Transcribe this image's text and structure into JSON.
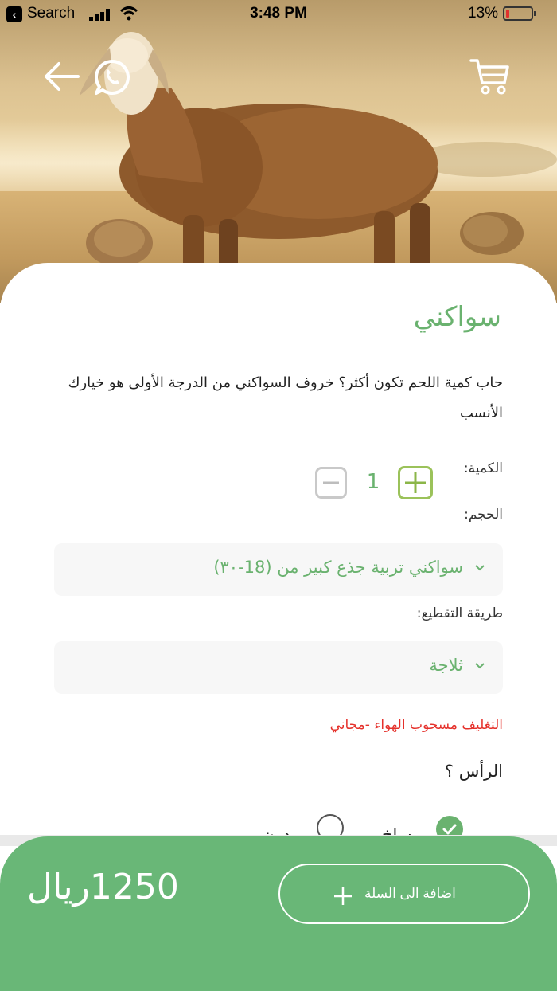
{
  "status_bar": {
    "back_app": "Search",
    "time": "3:48 PM",
    "battery_pct": "13%",
    "battery_level": 0.13
  },
  "product": {
    "title": "سواكني",
    "description": "حاب كمية اللحم تكون أكثر؟ خروف السواكني من الدرجة الأولى هو خيارك الأنسب"
  },
  "quantity": {
    "label": "الكمية:",
    "value": "1"
  },
  "size": {
    "label": "الحجم:",
    "selected": "سواكني تربية جذع كبير من (18-٣٠)"
  },
  "cutting": {
    "label": "طريقة التقطيع:",
    "selected": "ثلاجة"
  },
  "packaging_note": "التغليف مسحوب الهواء -مجاني",
  "head_question": "الرأس ؟",
  "head_options": [
    {
      "label": "ساخ",
      "checked": true
    },
    {
      "label": "بدون",
      "checked": false
    }
  ],
  "footer": {
    "price": "1250ريال",
    "add_to_cart_label": "اضافة الى السلة"
  },
  "colors": {
    "accent_green": "#6ab26f",
    "footer_green": "#69b777",
    "plus_green": "#8bb648",
    "alert_red": "#e5312b"
  },
  "icons": [
    "back-arrow-icon",
    "whatsapp-icon",
    "cart-icon",
    "minus-icon",
    "plus-icon",
    "chevron-down-icon",
    "check-icon"
  ]
}
